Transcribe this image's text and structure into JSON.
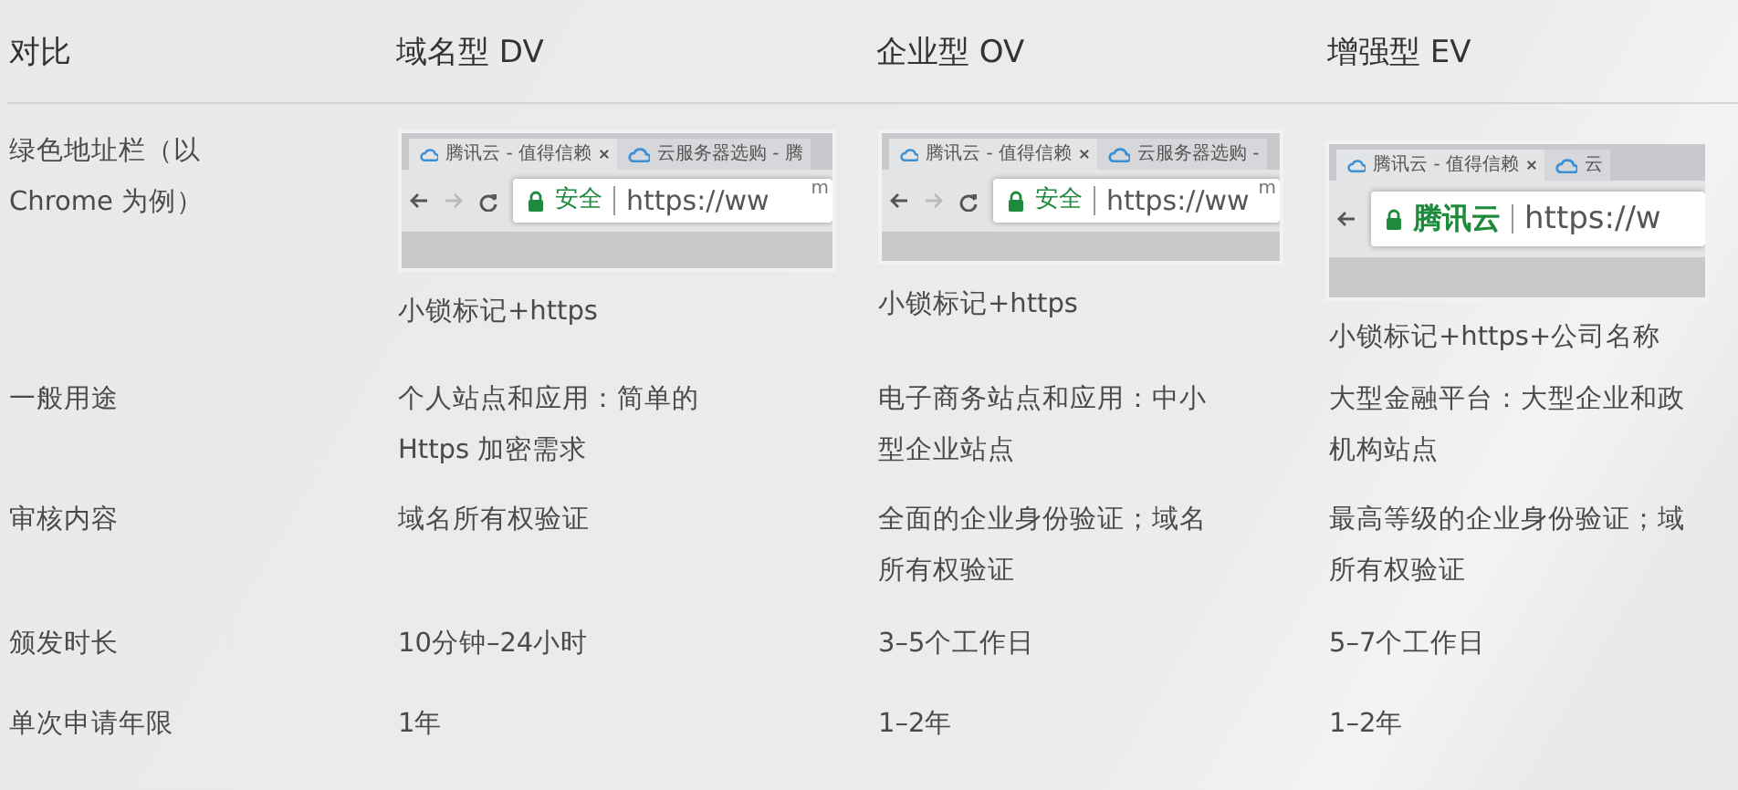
{
  "header": [
    "对比",
    "域名型 DV",
    "企业型 OV",
    "增强型 EV"
  ],
  "rows": [
    {
      "label": "绿色地址栏（以\nChrome 为例）",
      "cells": [
        {
          "kind": "browser",
          "tabs": [
            "腾讯云 - 值得信赖",
            "云服务器选购 - 腾"
          ],
          "badge_bold": false,
          "badge": "安全",
          "url": "https://ww",
          "url_tail": "m",
          "caption": "小锁标记+https"
        },
        {
          "kind": "browser",
          "tabs": [
            "腾讯云 - 值得信赖",
            "云服务器选购 -"
          ],
          "badge_bold": false,
          "badge": "安全",
          "url": "https://ww",
          "url_tail": "m",
          "caption": "小锁标记+https"
        },
        {
          "kind": "browser",
          "tabs": [
            "腾讯云 - 值得信赖",
            "云"
          ],
          "badge_bold": true,
          "badge": "腾讯云",
          "url": "https://w",
          "caption": "小锁标记+https+公司名称"
        }
      ]
    },
    {
      "label": "一般用途",
      "cells": [
        {
          "kind": "text",
          "text": "个人站点和应用：简单的\nHttps 加密需求"
        },
        {
          "kind": "text",
          "text": "电子商务站点和应用：中小型企业站点"
        },
        {
          "kind": "text",
          "text": "大型金融平台：大型企业和政机构站点"
        }
      ]
    },
    {
      "label": "审核内容",
      "cells": [
        {
          "kind": "text",
          "text": "域名所有权验证"
        },
        {
          "kind": "text",
          "text": "全面的企业身份验证；域名所有权验证"
        },
        {
          "kind": "text",
          "text": "最高等级的企业身份验证；域所有权验证"
        }
      ]
    },
    {
      "label": "颁发时长",
      "cells": [
        {
          "kind": "text",
          "text": "10分钟–24小时"
        },
        {
          "kind": "text",
          "text": "3–5个工作日"
        },
        {
          "kind": "text",
          "text": "5–7个工作日"
        }
      ]
    },
    {
      "label": "单次申请年限",
      "cells": [
        {
          "kind": "text",
          "text": "1年"
        },
        {
          "kind": "text",
          "text": "1–2年"
        },
        {
          "kind": "text",
          "text": "1–2年"
        }
      ]
    }
  ]
}
